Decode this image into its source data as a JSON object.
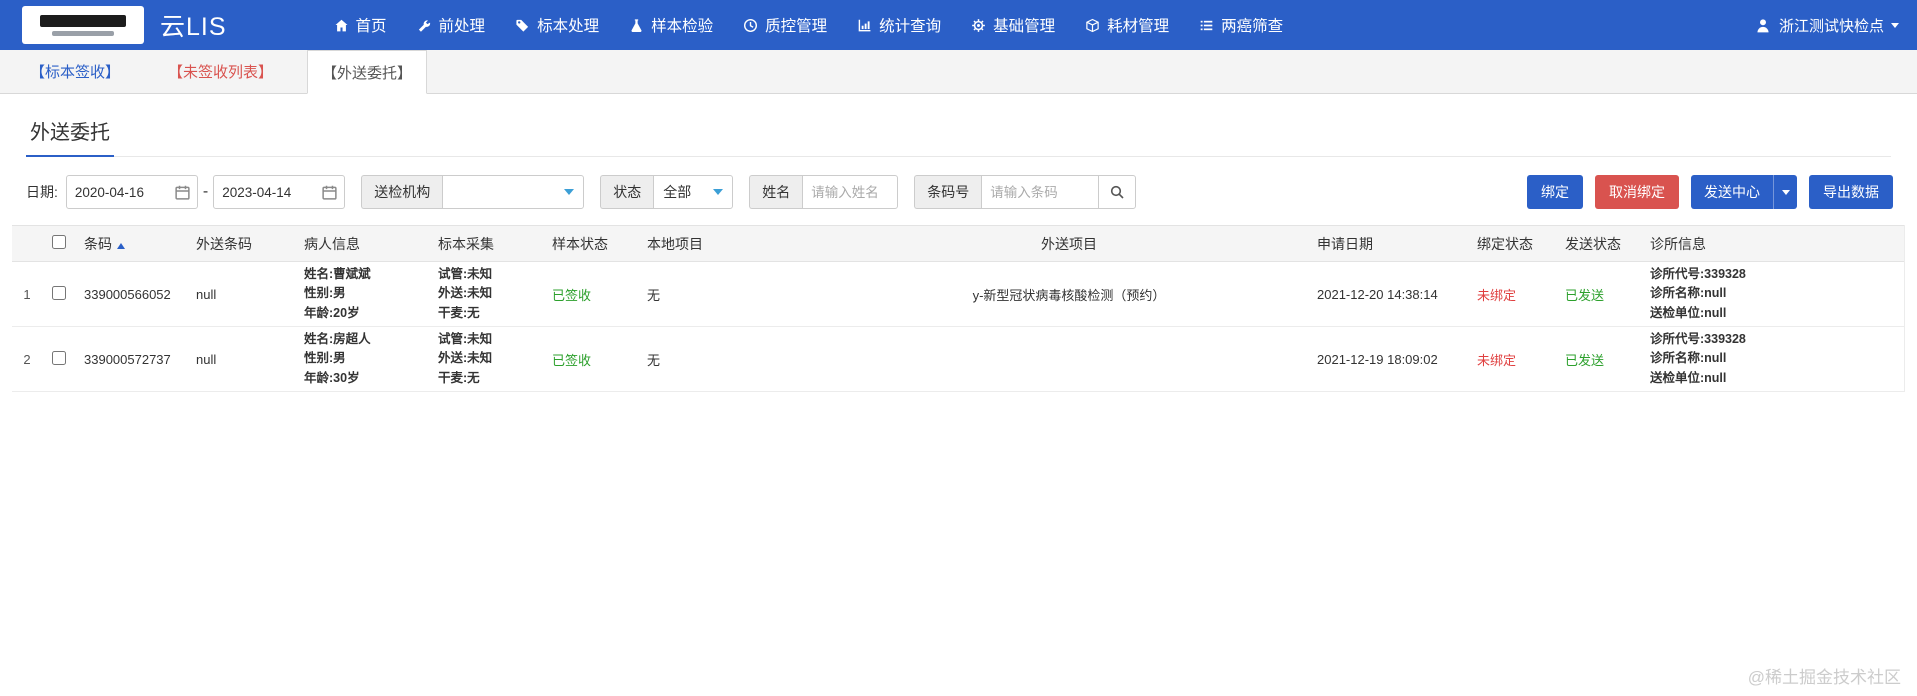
{
  "colors": {
    "primary": "#2b5fc7",
    "danger": "#d9534f",
    "success_text": "#2ca02c",
    "warning_text": "#e04040",
    "tabbar_bg": "#f4f4f4",
    "header_bg": "#f5f5f5"
  },
  "topbar": {
    "brand": "云LIS",
    "menu": [
      {
        "label": "首页"
      },
      {
        "label": "前处理"
      },
      {
        "label": "标本处理"
      },
      {
        "label": "样本检验"
      },
      {
        "label": "质控管理"
      },
      {
        "label": "统计查询"
      },
      {
        "label": "基础管理"
      },
      {
        "label": "耗材管理"
      },
      {
        "label": "两癌筛查"
      }
    ],
    "user": "浙江测试快检点"
  },
  "tabs": [
    {
      "label": "【标本签收】"
    },
    {
      "label": "【未签收列表】"
    },
    {
      "label": "【外送委托】"
    }
  ],
  "page": {
    "title": "外送委托"
  },
  "filters": {
    "date_label": "日期:",
    "date_from": "2020-04-16",
    "date_sep": "-",
    "date_to": "2023-04-14",
    "org_label": "送检机构",
    "org_value": "",
    "status_label": "状态",
    "status_value": "全部",
    "name_label": "姓名",
    "name_placeholder": "请输入姓名",
    "barcode_label": "条码号",
    "barcode_placeholder": "请输入条码"
  },
  "actions": {
    "bind": "绑定",
    "unbind": "取消绑定",
    "send_center": "发送中心",
    "export": "导出数据"
  },
  "table": {
    "headers": [
      "条码",
      "外送条码",
      "病人信息",
      "标本采集",
      "样本状态",
      "本地项目",
      "外送项目",
      "申请日期",
      "绑定状态",
      "发送状态",
      "诊所信息"
    ],
    "rows": [
      {
        "index": "1",
        "barcode": "339000566052",
        "out_barcode": "null",
        "patient": [
          "姓名:曹斌斌",
          "性别:男",
          "年龄:20岁"
        ],
        "collect": [
          "试管:未知",
          "外送:未知",
          "干麦:无"
        ],
        "sample_status": "已签收",
        "local_items": "无",
        "out_items": "y-新型冠状病毒核酸检测（预约）",
        "apply_date": "2021-12-20 14:38:14",
        "bind_status": "未绑定",
        "send_status": "已发送",
        "clinic": [
          "诊所代号:339328",
          "诊所名称:null",
          "送检单位:null"
        ]
      },
      {
        "index": "2",
        "barcode": "339000572737",
        "out_barcode": "null",
        "patient": [
          "姓名:房超人",
          "性别:男",
          "年龄:30岁"
        ],
        "collect": [
          "试管:未知",
          "外送:未知",
          "干麦:无"
        ],
        "sample_status": "已签收",
        "local_items": "无",
        "out_items": "",
        "apply_date": "2021-12-19 18:09:02",
        "bind_status": "未绑定",
        "send_status": "已发送",
        "clinic": [
          "诊所代号:339328",
          "诊所名称:null",
          "送检单位:null"
        ]
      }
    ]
  },
  "watermark": "@稀土掘金技术社区"
}
